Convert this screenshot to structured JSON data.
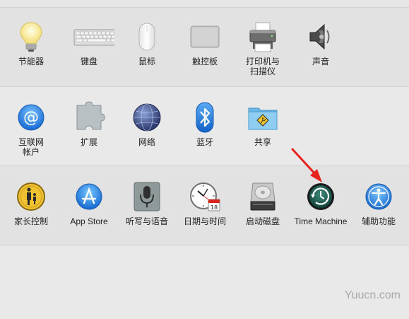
{
  "rows": [
    {
      "items": [
        {
          "label": "节能器",
          "icon": "lightbulb-icon"
        },
        {
          "label": "键盘",
          "icon": "keyboard-icon"
        },
        {
          "label": "鼠标",
          "icon": "mouse-icon"
        },
        {
          "label": "触控板",
          "icon": "trackpad-icon"
        },
        {
          "label": "打印机与\n扫描仪",
          "icon": "printer-icon"
        },
        {
          "label": "声音",
          "icon": "speaker-icon"
        }
      ]
    },
    {
      "items": [
        {
          "label": "互联网\n帐户",
          "icon": "at-sign-icon"
        },
        {
          "label": "扩展",
          "icon": "puzzle-piece-icon"
        },
        {
          "label": "网络",
          "icon": "globe-icon"
        },
        {
          "label": "蓝牙",
          "icon": "bluetooth-icon"
        },
        {
          "label": "共享",
          "icon": "shared-folder-icon"
        }
      ]
    },
    {
      "items": [
        {
          "label": "家长控制",
          "icon": "parental-control-icon"
        },
        {
          "label": "App Store",
          "icon": "app-store-icon"
        },
        {
          "label": "听写与语音",
          "icon": "microphone-icon"
        },
        {
          "label": "日期与时间",
          "icon": "clock-calendar-icon"
        },
        {
          "label": "启动磁盘",
          "icon": "hard-disk-icon"
        },
        {
          "label": "Time Machine",
          "icon": "time-machine-icon"
        },
        {
          "label": "辅助功能",
          "icon": "accessibility-icon"
        }
      ]
    }
  ],
  "calendar_day": "18",
  "watermark": "Yuucn.com",
  "colors": {
    "arrow": "#e8231f",
    "accent_blue": "#2d8de6"
  }
}
